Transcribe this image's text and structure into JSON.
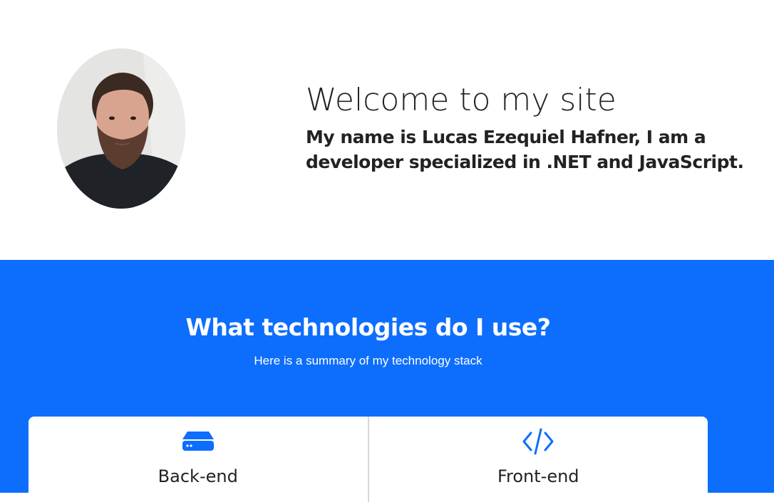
{
  "hero": {
    "title": "Welcome to my site",
    "subtitle": "My name is Lucas Ezequiel Hafner, I am a developer specialized in .NET and JavaScript."
  },
  "technologies": {
    "title": "What technologies do I use?",
    "subtitle": "Here is a summary of my technology stack",
    "cards": [
      {
        "label": "Back-end",
        "icon": "server-icon"
      },
      {
        "label": "Front-end",
        "icon": "code-icon"
      }
    ]
  },
  "colors": {
    "primary": "#0d6efd",
    "text": "#222222",
    "background": "#ffffff"
  }
}
